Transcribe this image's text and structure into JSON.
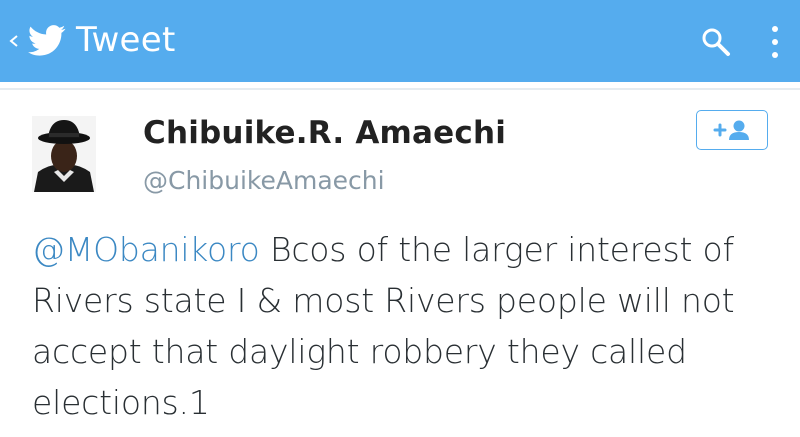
{
  "header": {
    "title": "Tweet",
    "icons": {
      "back": "chevron-left-icon",
      "logo": "twitter-bird-icon",
      "search": "search-icon",
      "menu": "overflow-menu-icon"
    },
    "color": "#55acee"
  },
  "tweet": {
    "author": {
      "display_name": "Chibuike.R. Amaechi",
      "handle": "@ChibuikeAmaechi"
    },
    "follow_icon": "follow-user-icon",
    "mention": "@MObanikoro",
    "text": " Bcos of the larger interest of Rivers state I & most Rivers people will not accept that daylight robbery they called elections.1"
  },
  "colors": {
    "accent": "#55acee",
    "mention": "#3b88c3",
    "text": "#292f33",
    "handle": "#8899a6"
  }
}
